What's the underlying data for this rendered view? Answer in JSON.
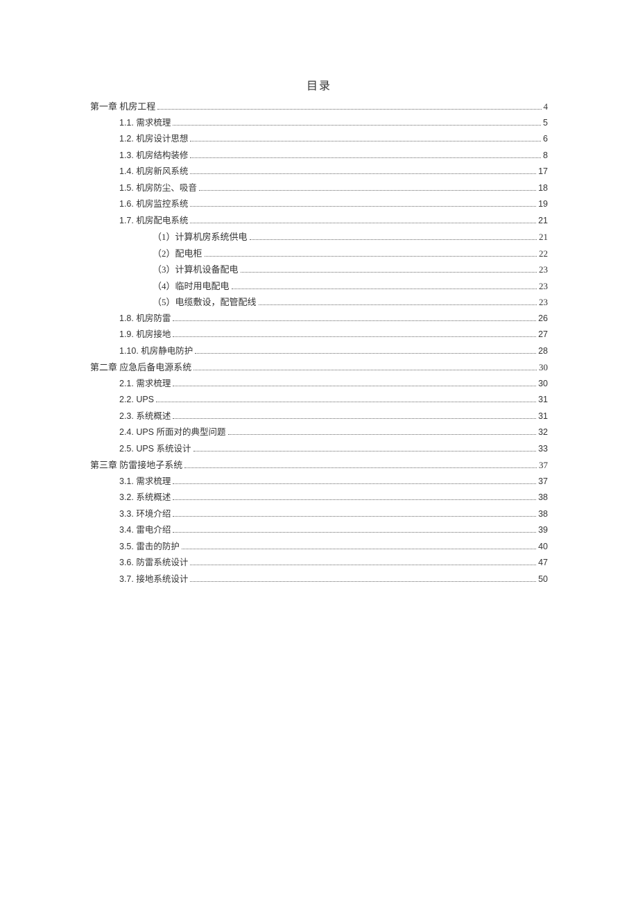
{
  "title": "目录",
  "entries": [
    {
      "level": 1,
      "label": "第一章 机房工程",
      "page": "4"
    },
    {
      "level": 2,
      "label": "1.1. 需求梳理",
      "page": "5"
    },
    {
      "level": 2,
      "label": "1.2. 机房设计思想",
      "page": "6"
    },
    {
      "level": 2,
      "label": "1.3. 机房结构装修",
      "page": "8"
    },
    {
      "level": 2,
      "label": "1.4. 机房新风系统",
      "page": "17"
    },
    {
      "level": 2,
      "label": "1.5. 机房防尘、吸音",
      "page": "18"
    },
    {
      "level": 2,
      "label": "1.6. 机房监控系统",
      "page": "19"
    },
    {
      "level": 2,
      "label": "1.7. 机房配电系统",
      "page": "21"
    },
    {
      "level": 3,
      "label": "（1）计算机房系统供电",
      "page": "21"
    },
    {
      "level": 3,
      "label": "（2）配电柜",
      "page": "22"
    },
    {
      "level": 3,
      "label": "（3）计算机设备配电",
      "page": "23"
    },
    {
      "level": 3,
      "label": "（4）临时用电配电",
      "page": "23"
    },
    {
      "level": 3,
      "label": "（5）电缆敷设，配管配线",
      "page": "23"
    },
    {
      "level": 2,
      "label": "1.8. 机房防雷",
      "page": "26"
    },
    {
      "level": 2,
      "label": "1.9. 机房接地",
      "page": "27"
    },
    {
      "level": 2,
      "label": "1.10. 机房静电防护",
      "page": "28"
    },
    {
      "level": 1,
      "label": "第二章 应急后备电源系统",
      "page": "30"
    },
    {
      "level": 2,
      "label": "2.1. 需求梳理",
      "page": "30"
    },
    {
      "level": 2,
      "label": "2.2. UPS",
      "page": "31"
    },
    {
      "level": 2,
      "label": "2.3. 系统概述",
      "page": "31"
    },
    {
      "level": 2,
      "label": "2.4. UPS 所面对的典型问题",
      "page": "32"
    },
    {
      "level": 2,
      "label": "2.5. UPS 系统设计",
      "page": "33"
    },
    {
      "level": 1,
      "label": "第三章 防雷接地子系统",
      "page": "37"
    },
    {
      "level": 2,
      "label": "3.1. 需求梳理",
      "page": "37"
    },
    {
      "level": 2,
      "label": "3.2. 系统概述",
      "page": "38"
    },
    {
      "level": 2,
      "label": "3.3. 环境介绍",
      "page": "38"
    },
    {
      "level": 2,
      "label": "3.4. 雷电介绍",
      "page": "39"
    },
    {
      "level": 2,
      "label": "3.5. 雷击的防护",
      "page": "40"
    },
    {
      "level": 2,
      "label": "3.6. 防雷系统设计",
      "page": "47"
    },
    {
      "level": 2,
      "label": "3.7. 接地系统设计",
      "page": "50"
    }
  ]
}
